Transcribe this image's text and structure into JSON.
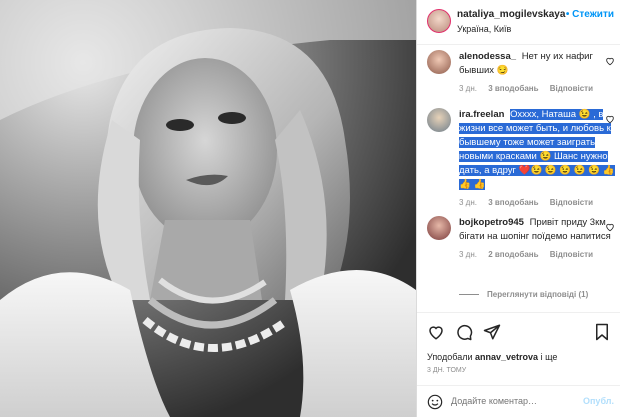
{
  "post": {
    "username": "nataliya_mogilevskaya",
    "follow_label": "• Стежити",
    "location": "Україна, Київ"
  },
  "comments": [
    {
      "username": "alenodessa_",
      "text_plain": "Нет ну их нафиг бывших",
      "emoji": "😏",
      "time": "3 дн.",
      "likes": "3 вподобань",
      "reply": "Відповісти"
    },
    {
      "username": "ira.freelan",
      "text_highlighted": "Охххх, Наташа 😉 , в жизни все может быть, и любовь к бывшему тоже может заиграть новыми красками 😉 Шанс нужно дать, а вдруг ❤️😉 😉 😉 😉 😉 👍 👍 👍",
      "time": "3 дн.",
      "likes": "3 вподобань",
      "reply": "Відповісти"
    },
    {
      "username": "bojkopetro945",
      "text_plain": "Привіт приду 3км бігати на шопінг поїдемо напитися",
      "time": "3 дн.",
      "likes": "2 вподобань",
      "reply": "Відповісти"
    }
  ],
  "view_replies": "Переглянути відповіді (1)",
  "liked_by": {
    "prefix": "Уподобали",
    "user": "annav_vetrova",
    "suffix": "і ще"
  },
  "post_date": "3 ДН. ТОМУ",
  "add_comment": {
    "placeholder": "Додайте коментар…",
    "publish": "Опубл."
  },
  "icons": [
    "heart-icon",
    "comment-icon",
    "share-icon",
    "bookmark-icon",
    "emoji-icon"
  ],
  "colors": {
    "accent": "#0095f6",
    "highlight": "#2a6ad6",
    "muted": "#8e8e8e"
  }
}
